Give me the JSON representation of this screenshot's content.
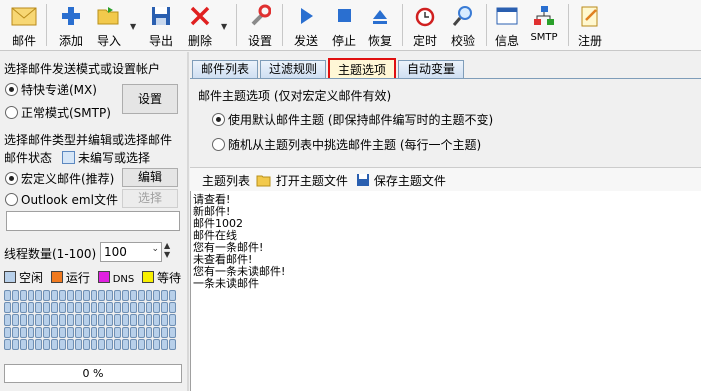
{
  "toolbar": {
    "mail": "邮件",
    "add": "添加",
    "import": "导入",
    "export": "导出",
    "delete": "删除",
    "settings": "设置",
    "send": "发送",
    "stop": "停止",
    "resume": "恢复",
    "timer": "定时",
    "verify": "校验",
    "info": "信息",
    "smtp": "SMTP",
    "register": "注册"
  },
  "left": {
    "send_mode_title": "选择邮件发送模式或设置帐户",
    "mode_mx": "特快专递(MX)",
    "mode_smtp": "正常模式(SMTP)",
    "settings_button": "设置",
    "type_title": "选择邮件类型并编辑或选择邮件",
    "status_label": "邮件状态",
    "status_check": "未编写或选择",
    "macro_mail": "宏定义邮件(推荐)",
    "edit_button": "编辑",
    "outlook_eml": "Outlook eml文件",
    "select_button": "选择",
    "thread_label": "线程数量(1-100)",
    "thread_value": "100",
    "legend": [
      {
        "label": "空闲",
        "color": "#b8d0ea"
      },
      {
        "label": "运行",
        "color": "#f07a20"
      },
      {
        "label": "DNS",
        "color": "#e020e0"
      },
      {
        "label": "等待",
        "color": "#f8f000"
      }
    ],
    "progress": "0 %"
  },
  "tabs": [
    "邮件列表",
    "过滤规则",
    "主题选项",
    "自动变量"
  ],
  "panel": {
    "title": "邮件主题选项 (仅对宏定义邮件有效)",
    "option_default": "使用默认邮件主题 (即保持邮件编写时的主题不变)",
    "option_random": "随机从主题列表中挑选邮件主题 (每行一个主题)"
  },
  "subbar": {
    "list": "主题列表",
    "open": "打开主题文件",
    "save": "保存主题文件"
  },
  "subjects": [
    "请查看!",
    "新邮件!",
    "邮件1002",
    "邮件在线",
    "您有一条邮件!",
    "未查看邮件!",
    "您有一条未读邮件!",
    "一条未读邮件"
  ]
}
